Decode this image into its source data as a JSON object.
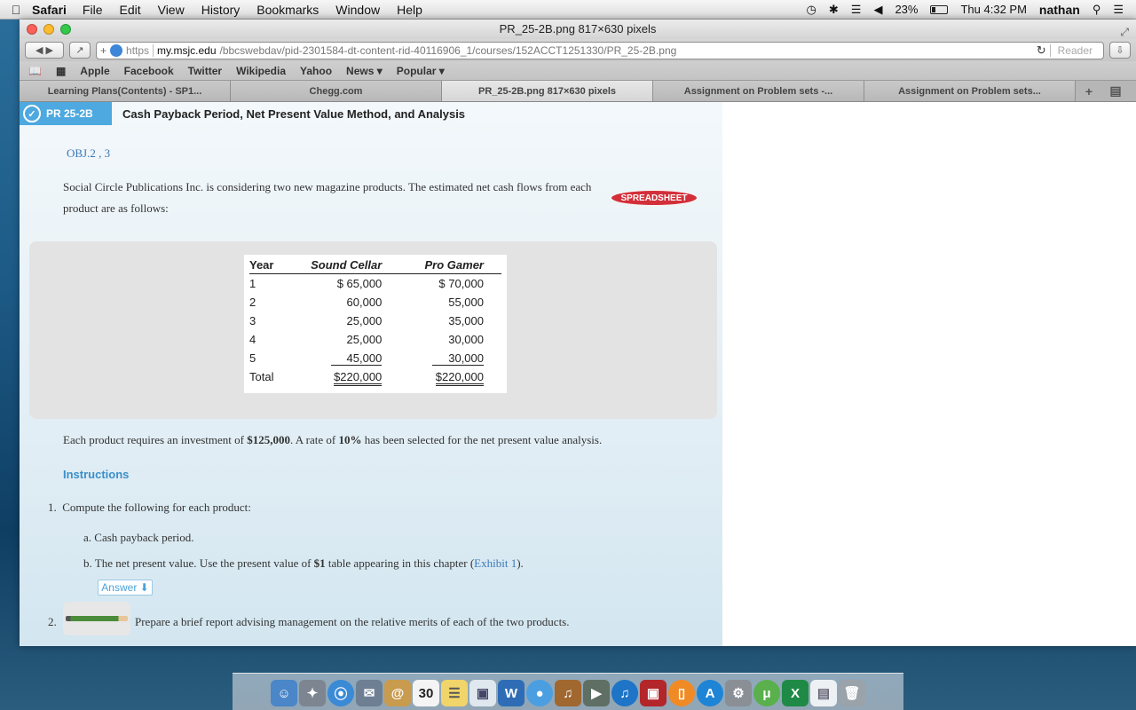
{
  "menubar": {
    "app": "Safari",
    "items": [
      "File",
      "Edit",
      "View",
      "History",
      "Bookmarks",
      "Window",
      "Help"
    ],
    "battery": "23%",
    "clock": "Thu 4:32 PM",
    "user": "nathan"
  },
  "window": {
    "title": "PR_25-2B.png 817×630 pixels",
    "url_scheme": "https",
    "url_host": "my.msjc.edu",
    "url_path": "/bbcswebdav/pid-2301584-dt-content-rid-40116906_1/courses/152ACCT1251330/PR_25-2B.png",
    "reader": "Reader"
  },
  "bookmarks": [
    "Apple",
    "Facebook",
    "Twitter",
    "Wikipedia",
    "Yahoo",
    "News ▾",
    "Popular ▾"
  ],
  "tabs": [
    "Learning Plans(Contents) - SP1...",
    "Chegg.com",
    "PR_25-2B.png 817×630 pixels",
    "Assignment on Problem sets -...",
    "Assignment on Problem sets..."
  ],
  "problem": {
    "tag": "PR 25-2B",
    "title": "Cash Payback Period, Net Present Value Method, and Analysis",
    "obj": "OBJ.2 , 3",
    "intro": "Social Circle Publications Inc. is considering two new magazine products. The estimated net cash flows from each product are as follows:",
    "spreadsheet": "SPREADSHEET",
    "investment_text_pre": "Each product requires an investment of ",
    "investment_amount": "$125,000",
    "investment_text_mid": ". A rate of ",
    "rate": "10%",
    "investment_text_post": " has been selected for the net present value analysis.",
    "instructions_label": "Instructions",
    "q1_num": "1.",
    "q1": "Compute the following for each product:",
    "qa": "a.  Cash payback period.",
    "qb_pre": "b.  The net present value. Use the present value of ",
    "qb_bold": "$1",
    "qb_mid": " table appearing in this chapter (",
    "qb_link": "Exhibit 1",
    "qb_post": ").",
    "answer_label": "Answer ⬇",
    "q2_num": "2.",
    "q2": "Prepare a brief report advising management on the relative merits of each of the two products."
  },
  "cash_table": {
    "headers": [
      "Year",
      "Sound Cellar",
      "Pro Gamer"
    ],
    "rows": [
      [
        "1",
        "$ 65,000",
        "$ 70,000"
      ],
      [
        "2",
        "60,000",
        "55,000"
      ],
      [
        "3",
        "25,000",
        "35,000"
      ],
      [
        "4",
        "25,000",
        "30,000"
      ],
      [
        "5",
        "45,000",
        "30,000"
      ]
    ],
    "total": [
      "Total",
      "$220,000",
      "$220,000"
    ]
  },
  "dock_icons": [
    "finder-icon",
    "launchpad-icon",
    "safari-icon",
    "mail-icon",
    "contacts-icon",
    "calendar-icon",
    "notes-icon",
    "preview-icon",
    "word-icon",
    "messages-icon",
    "garageband-icon",
    "facetime-icon",
    "itunes-icon",
    "photobooth-icon",
    "ibooks-icon",
    "appstore-icon",
    "system-preferences-icon",
    "utorrent-icon",
    "excel-icon",
    "documents-icon",
    "trash-icon"
  ],
  "dock_badge": "30"
}
